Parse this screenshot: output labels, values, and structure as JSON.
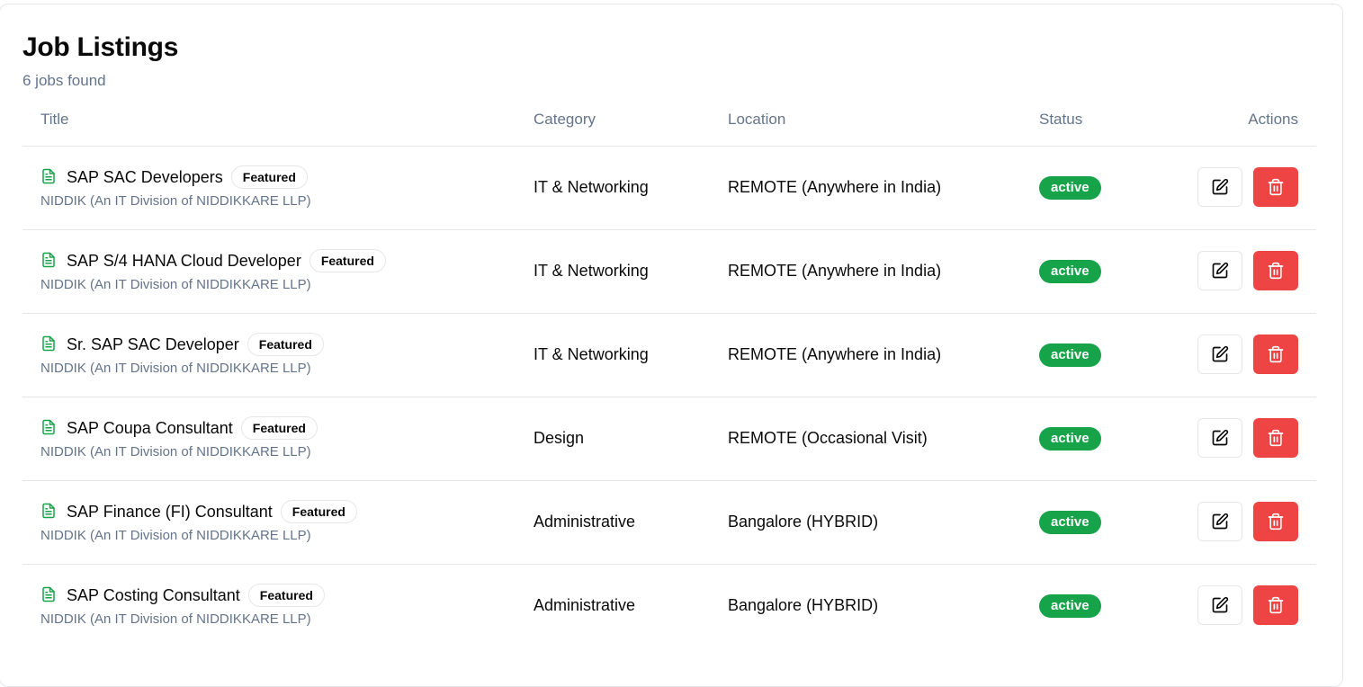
{
  "header": {
    "title": "Job Listings",
    "count_text": "6 jobs found"
  },
  "table": {
    "columns": {
      "title": "Title",
      "category": "Category",
      "location": "Location",
      "status": "Status",
      "actions": "Actions"
    }
  },
  "colors": {
    "status_active": "#16a34a",
    "delete": "#ef4444",
    "doc_icon": "#16a34a",
    "muted_text": "#64748b"
  },
  "icons": {
    "job": "document-icon",
    "edit": "edit-icon",
    "delete": "trash-icon"
  },
  "jobs": [
    {
      "title": "SAP SAC Developers",
      "badge": "Featured",
      "company": "NIDDIK (An IT Division of NIDDIKKARE LLP)",
      "category": "IT & Networking",
      "location": "REMOTE (Anywhere in India)",
      "status": "active"
    },
    {
      "title": "SAP S/4 HANA Cloud Developer",
      "badge": "Featured",
      "company": "NIDDIK (An IT Division of NIDDIKKARE LLP)",
      "category": "IT & Networking",
      "location": "REMOTE (Anywhere in India)",
      "status": "active"
    },
    {
      "title": "Sr. SAP SAC Developer",
      "badge": "Featured",
      "company": "NIDDIK (An IT Division of NIDDIKKARE LLP)",
      "category": "IT & Networking",
      "location": "REMOTE (Anywhere in India)",
      "status": "active"
    },
    {
      "title": "SAP Coupa Consultant",
      "badge": "Featured",
      "company": "NIDDIK (An IT Division of NIDDIKKARE LLP)",
      "category": "Design",
      "location": "REMOTE (Occasional Visit)",
      "status": "active"
    },
    {
      "title": "SAP Finance (FI) Consultant",
      "badge": "Featured",
      "company": "NIDDIK (An IT Division of NIDDIKKARE LLP)",
      "category": "Administrative",
      "location": "Bangalore (HYBRID)",
      "status": "active"
    },
    {
      "title": "SAP Costing Consultant",
      "badge": "Featured",
      "company": "NIDDIK (An IT Division of NIDDIKKARE LLP)",
      "category": "Administrative",
      "location": "Bangalore (HYBRID)",
      "status": "active"
    }
  ]
}
